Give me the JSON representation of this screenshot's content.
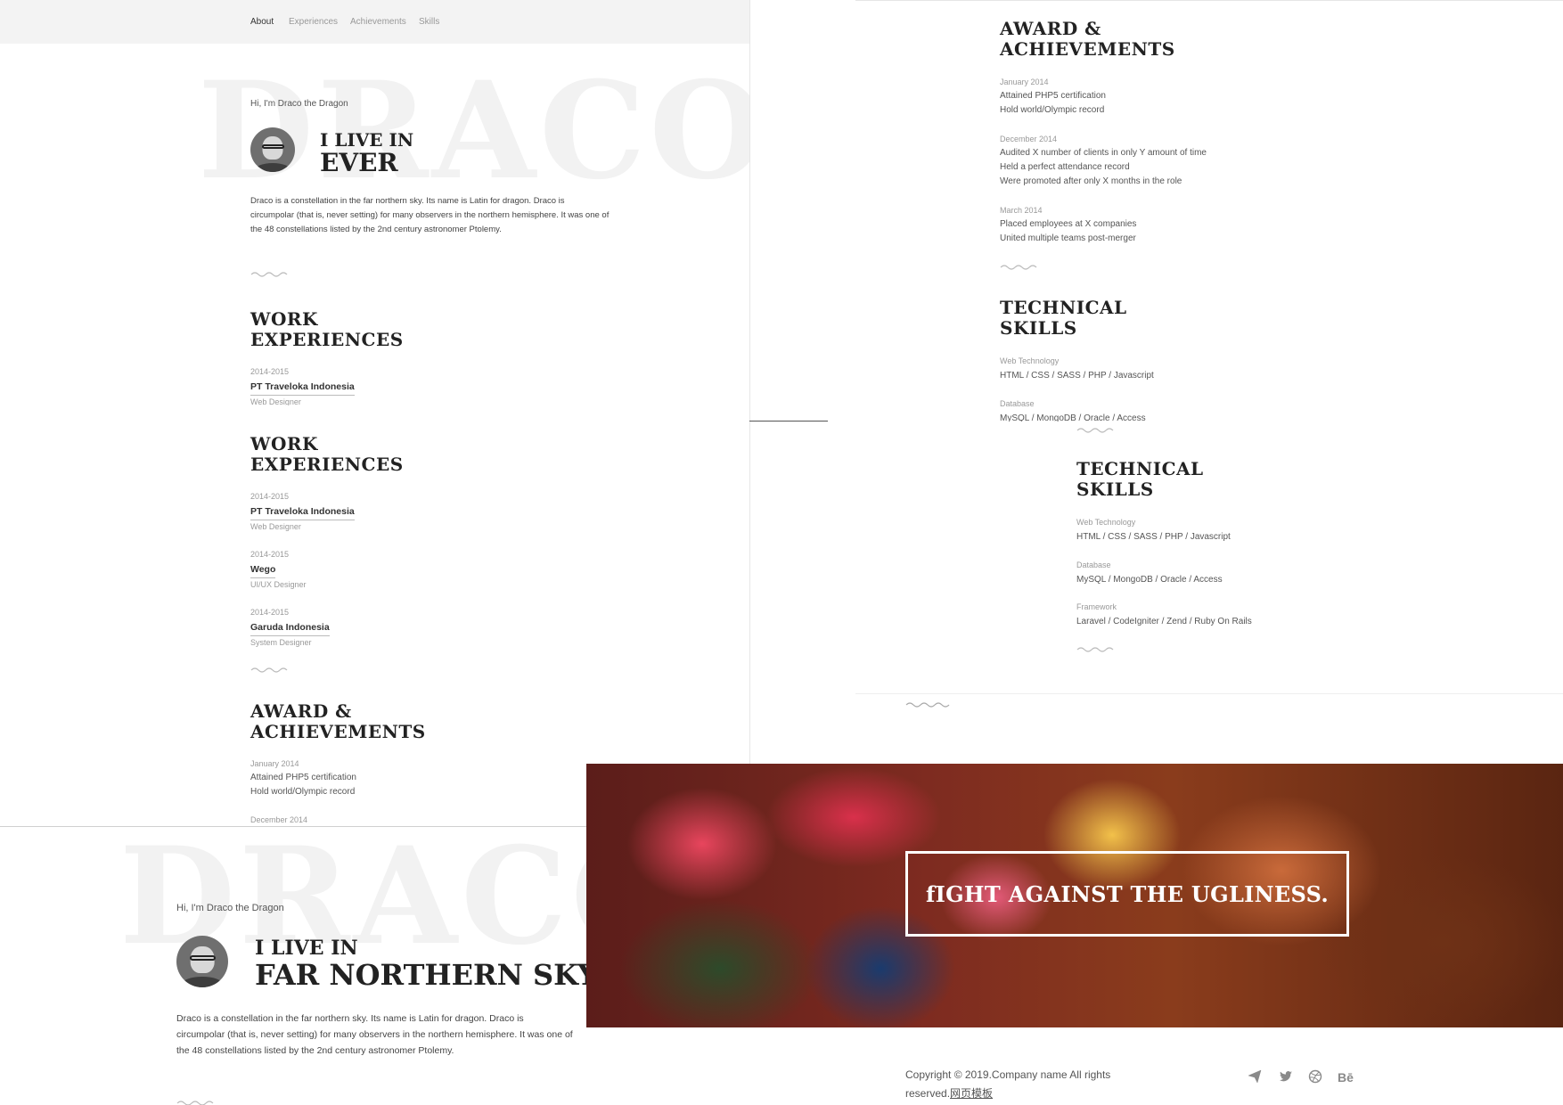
{
  "nav": {
    "items": [
      "About",
      "Experiences",
      "Achievements",
      "Skills"
    ]
  },
  "hero1": {
    "bg_word": "DRACO",
    "greeting": "Hi, I'm Draco the Dragon",
    "line1": "I LIVE IN",
    "line2": "EVER",
    "description_lines": [
      "Draco is a constellation in the far northern sky. Its name is Latin for dragon. Draco is",
      "circumpolar (that is, never setting) for many observers in the northern hemisphere. It was one of",
      "the 48 constellations listed by the 2nd century astronomer Ptolemy."
    ]
  },
  "work": {
    "title_line1": "WORK",
    "title_line2": "EXPERIENCES",
    "jobs": [
      {
        "years": "2014-2015",
        "company": "PT Traveloka Indonesia",
        "role": "Web Designer"
      },
      {
        "years": "2014-2015",
        "company": "Wego",
        "role": "UI/UX Designer"
      },
      {
        "years": "2014-2015",
        "company": "Garuda Indonesia",
        "role": "System Designer"
      }
    ]
  },
  "awards": {
    "title_line1": "AWARD &",
    "title_line2": "ACHIEVEMENTS",
    "groups": [
      {
        "date": "January 2014",
        "items": [
          "Attained PHP5 certification",
          "Hold world/Olympic record"
        ]
      },
      {
        "date": "December 2014",
        "items": [
          "Audited X number of clients in only Y amount of time",
          "Held a perfect attendance record",
          "Were promoted after only X months in the role"
        ]
      },
      {
        "date": "March 2014",
        "items": [
          "Placed employees at X companies",
          "United multiple teams post-merger"
        ]
      }
    ]
  },
  "skills": {
    "title_line1": "TECHNICAL",
    "title_line2": "SKILLS",
    "groups": [
      {
        "label": "Web Technology",
        "value": "HTML / CSS / SASS / PHP / Javascript"
      },
      {
        "label": "Database",
        "value": "MySQL / MongoDB / Oracle / Access"
      },
      {
        "label": "Framework",
        "value": "Laravel / CodeIgniter / Zend / Ruby On Rails"
      }
    ]
  },
  "hero2": {
    "bg_word": "DRACO",
    "greeting": "Hi, I'm Draco the Dragon",
    "line1": "I LIVE IN",
    "line2": "FAR NORTHERN SKY",
    "description_lines": [
      "Draco is a constellation in the far northern sky. Its name is Latin for dragon. Draco is",
      "circumpolar (that is, never setting) for many observers in the northern hemisphere. It was one of",
      "the 48 constellations listed by the 2nd century astronomer Ptolemy."
    ]
  },
  "banner": {
    "text": "fIGHT AGAINST THE UGLINESS."
  },
  "footer": {
    "copyright_line1": "Copyright © 2019.Company name All rights",
    "copyright_line2": "reserved.",
    "link": "网页模板",
    "social_icons": [
      "paper-plane-icon",
      "twitter-icon",
      "dribbble-icon",
      "behance-icon"
    ],
    "behance_text": "Bē"
  }
}
